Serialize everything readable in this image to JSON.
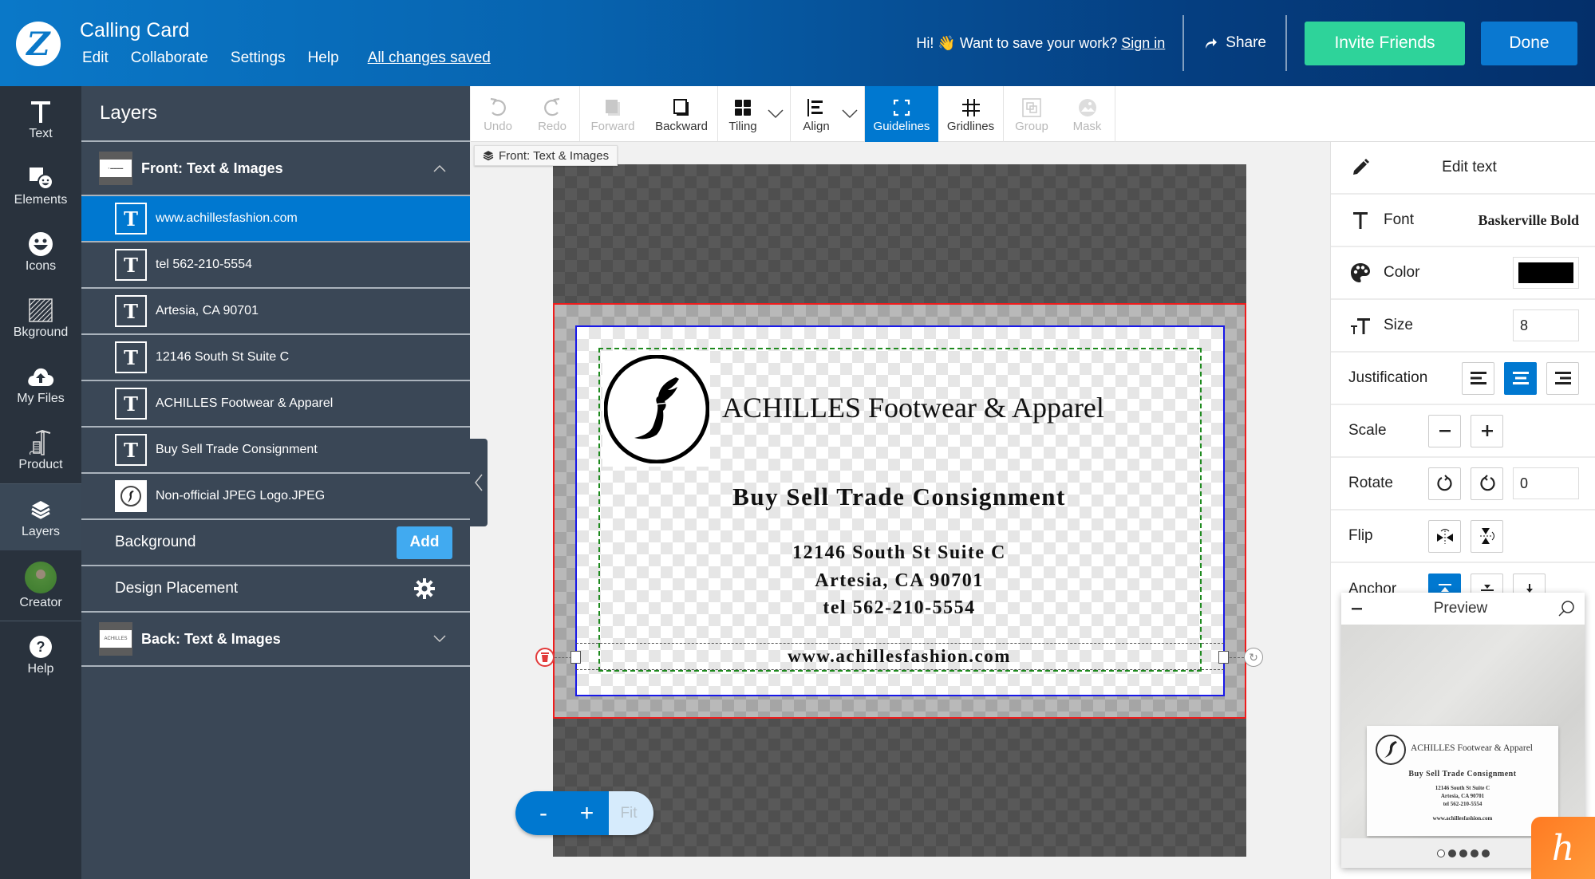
{
  "header": {
    "app_title": "Calling Card",
    "menu": [
      "Edit",
      "Collaborate",
      "Settings",
      "Help"
    ],
    "save_status": "All changes saved",
    "save_prompt": "Hi! 👋 Want to save your work?",
    "sign_in": "Sign in",
    "share": "Share",
    "invite": "Invite Friends",
    "done": "Done"
  },
  "rail": {
    "items": [
      {
        "label": "Text",
        "icon": "text-icon"
      },
      {
        "label": "Elements",
        "icon": "elements-icon"
      },
      {
        "label": "Icons",
        "icon": "smiley-icon"
      },
      {
        "label": "Bkground",
        "icon": "background-icon"
      },
      {
        "label": "My Files",
        "icon": "cloud-upload-icon"
      },
      {
        "label": "Product",
        "icon": "product-icon"
      },
      {
        "label": "Layers",
        "icon": "layers-icon"
      },
      {
        "label": "Creator",
        "icon": "avatar"
      },
      {
        "label": "Help",
        "icon": "help-icon"
      }
    ],
    "active": "Layers"
  },
  "layers": {
    "title": "Layers",
    "front_section": "Front: Text & Images",
    "items": [
      {
        "label": "www.achillesfashion.com",
        "type": "text",
        "selected": true
      },
      {
        "label": "tel 562-210-5554",
        "type": "text"
      },
      {
        "label": "Artesia, CA 90701",
        "type": "text"
      },
      {
        "label": "12146 South St Suite C",
        "type": "text"
      },
      {
        "label": "ACHILLES Footwear & Apparel",
        "type": "text"
      },
      {
        "label": "Buy Sell Trade Consignment",
        "type": "text"
      },
      {
        "label": "Non-official JPEG Logo.JPEG",
        "type": "image"
      }
    ],
    "background_label": "Background",
    "add_label": "Add",
    "design_placement": "Design Placement",
    "back_section": "Back: Text & Images",
    "back_thumb_text": "ACHILLES"
  },
  "toolbar": {
    "tools": [
      {
        "label": "Undo",
        "disabled": true
      },
      {
        "label": "Redo",
        "disabled": true
      },
      {
        "label": "Forward",
        "disabled": true
      },
      {
        "label": "Backward",
        "disabled": false
      },
      {
        "label": "Tiling",
        "disabled": false
      },
      {
        "label": "Align",
        "disabled": false
      },
      {
        "label": "Guidelines",
        "active": true
      },
      {
        "label": "Gridlines",
        "disabled": false
      },
      {
        "label": "Group",
        "disabled": true
      },
      {
        "label": "Mask",
        "disabled": true
      }
    ]
  },
  "breadcrumb": "Front: Text & Images",
  "card": {
    "name": "ACHILLES Footwear & Apparel",
    "tagline": "Buy Sell Trade Consignment",
    "address1": "12146 South St Suite C",
    "address2": "Artesia, CA 90701",
    "phone": "tel 562-210-5554",
    "website": "www.achillesfashion.com"
  },
  "zoom": {
    "minus": "-",
    "plus": "+",
    "fit": "Fit"
  },
  "properties": {
    "edit_text": "Edit text",
    "font_label": "Font",
    "font_value": "Baskerville Bold",
    "color_label": "Color",
    "color_value": "#000000",
    "size_label": "Size",
    "size_value": "8",
    "justification_label": "Justification",
    "justification_active": "center",
    "scale_label": "Scale",
    "rotate_label": "Rotate",
    "rotate_value": "0",
    "flip_label": "Flip",
    "anchor_label": "Anchor"
  },
  "preview": {
    "title": "Preview",
    "pages": 5,
    "current_page": 1
  },
  "colors": {
    "accent": "#0078d0",
    "invite": "#2ed39a",
    "add": "#41aaf0",
    "bleed": "#ee1c1c",
    "trim": "#1818e8",
    "safe": "#1e8a1e"
  }
}
